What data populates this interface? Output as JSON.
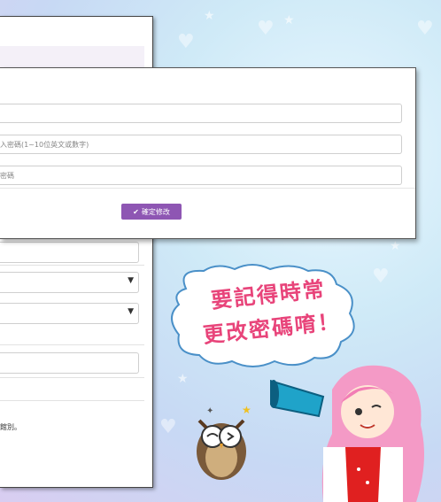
{
  "modal": {
    "password_placeholder": "入密碼(1~10位英文或數字)",
    "confirm_placeholder": "密碼",
    "confirm_button_label": "確定修改",
    "confirm_button_icon": "check-icon"
  },
  "back_panel": {
    "note_text": "館別。"
  },
  "promo": {
    "bubble_line1": "要記得時常",
    "bubble_line2": "更改密碼唷！"
  },
  "colors": {
    "accent": "#8e56b3",
    "bubble_text": "#e8447a"
  }
}
